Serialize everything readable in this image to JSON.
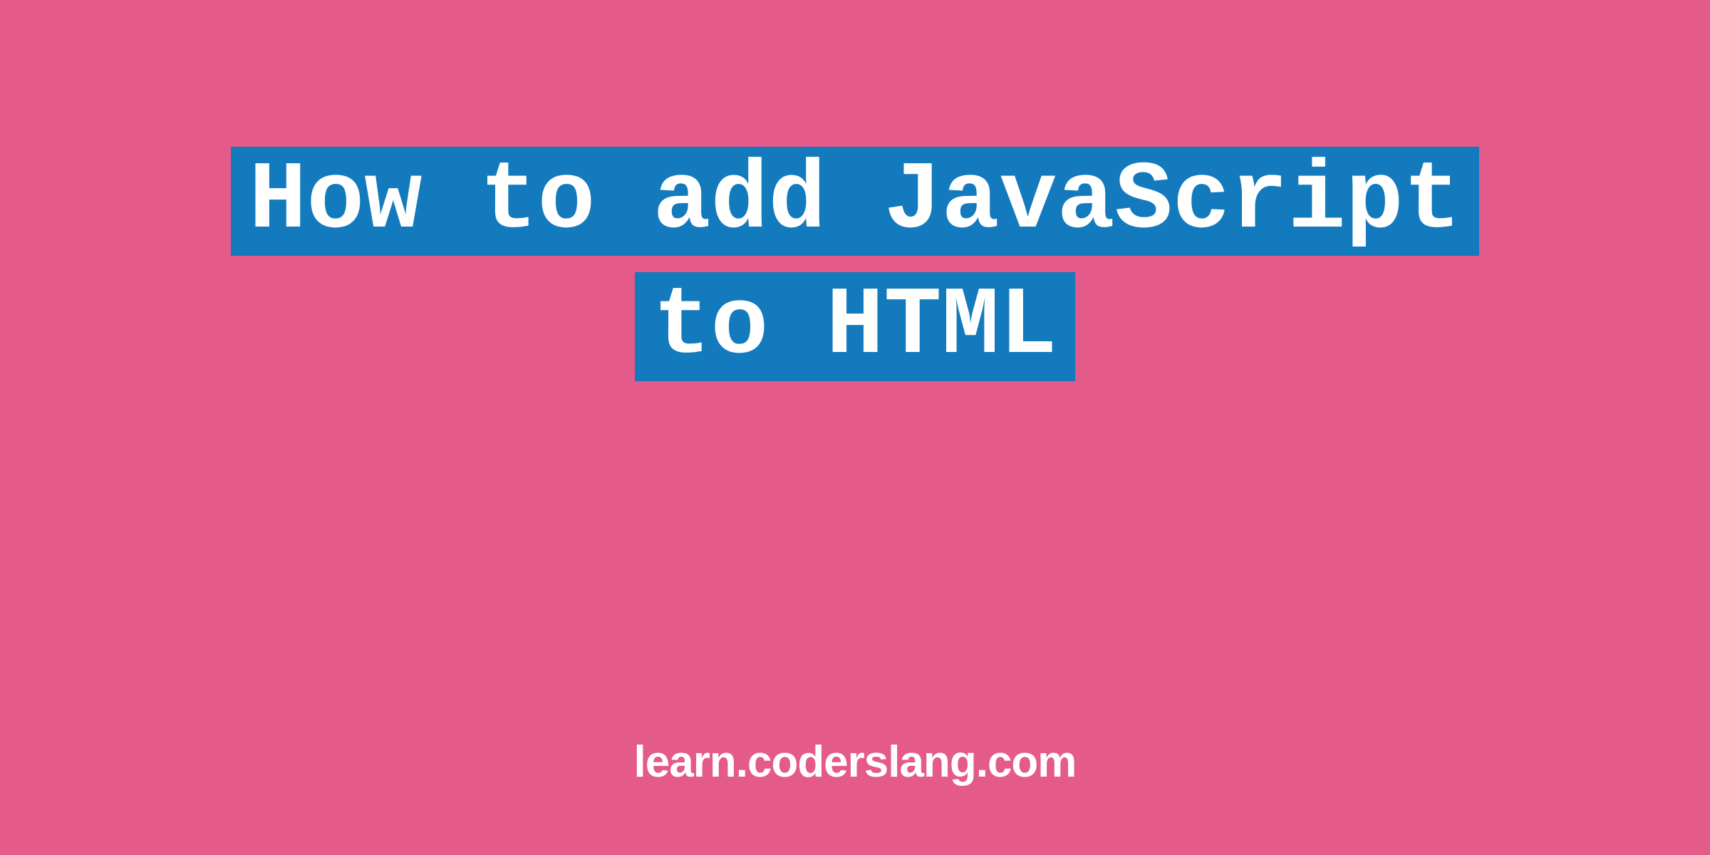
{
  "title": {
    "line1": "How to add JavaScript",
    "line2": "to HTML"
  },
  "footer": {
    "domain": "learn.coderslang.com"
  },
  "colors": {
    "background": "#e45a89",
    "highlight": "#137abd",
    "text": "#ffffff"
  }
}
